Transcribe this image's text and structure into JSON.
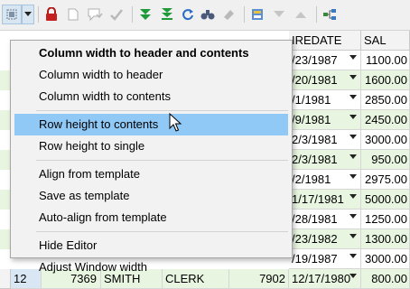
{
  "toolbar": {
    "icons": [
      "select-rows-icon",
      "dropdown-arrow-icon",
      "lock-icon",
      "new-record-icon",
      "comment-icon",
      "check-icon",
      "move-down-icon",
      "move-bottom-icon",
      "refresh-icon",
      "find-icon",
      "eraser-icon",
      "export-icon",
      "filter-down-icon",
      "filter-up-icon",
      "tree-icon"
    ]
  },
  "grid": {
    "headers": {
      "hiredate": "IREDATE",
      "sal": "SAL"
    },
    "rows": [
      {
        "hiredate": "/23/1987",
        "sal": "1100.00"
      },
      {
        "hiredate": "/20/1981",
        "sal": "1600.00"
      },
      {
        "hiredate": "/1/1981",
        "sal": "2850.00"
      },
      {
        "hiredate": "/9/1981",
        "sal": "2450.00"
      },
      {
        "hiredate": "2/3/1981",
        "sal": "3000.00"
      },
      {
        "hiredate": "2/3/1981",
        "sal": "950.00"
      },
      {
        "hiredate": "/2/1981",
        "sal": "2975.00"
      },
      {
        "hiredate": "1/17/1981",
        "sal": "5000.00"
      },
      {
        "hiredate": "/28/1981",
        "sal": "1250.00"
      },
      {
        "hiredate": "/23/1982",
        "sal": "1300.00"
      },
      {
        "hiredate": "/19/1987",
        "sal": "3000.00"
      }
    ],
    "last_row": {
      "num": "12",
      "id": "7369",
      "name": "SMITH",
      "job": "CLERK",
      "mgr": "7902",
      "hiredate": "12/17/1980",
      "sal": "800.00"
    }
  },
  "menu": {
    "items": [
      {
        "label": "Column width to header and contents",
        "bold": true
      },
      {
        "label": "Column width to header"
      },
      {
        "label": "Column width to contents"
      },
      {
        "label": "Row height to contents",
        "highlighted": true
      },
      {
        "label": "Row height to single"
      },
      {
        "label": "Align from template"
      },
      {
        "label": "Save as template"
      },
      {
        "label": "Auto-align from template"
      },
      {
        "label": "Hide Editor"
      },
      {
        "label": "Adjust Window width"
      }
    ]
  },
  "colors": {
    "highlight": "#90c8f6",
    "green_row": "#e8f5e0",
    "toolbar": "#f0f0f0"
  }
}
